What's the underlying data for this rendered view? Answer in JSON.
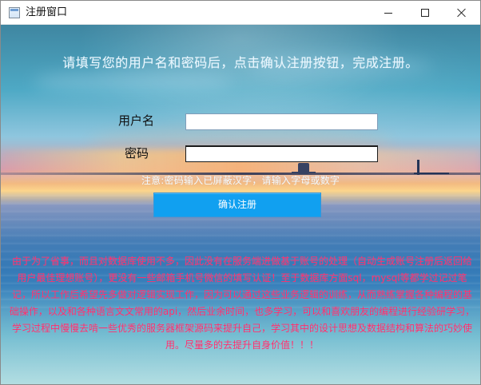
{
  "window": {
    "title": "注册窗口"
  },
  "form": {
    "heading": "请填写您的用户名和密码后，点击确认注册按钮，完成注册。",
    "username_label": "用户名",
    "password_label": "密码",
    "username_value": "",
    "password_value": "",
    "note": "注意:密码输入已屏蔽汉字，请输入字母或数字",
    "submit_label": "确认注册"
  },
  "description": {
    "text": "由于为了省事，而且对数据库使用不多，因此没有在服务端进做基于账号的处理（自动生成账号注册后返回给用户最佳理想账号），更没有一些邮箱手机号微信的填写认证！至于数据库方面sql，mysql等都学过记过笔记，所以工作后希望先多做对逻辑实现工作，因为可以通过这些业务逻辑的训练，从而熟练掌握各种编程的基础操作，以及和各种语言文文常用的api，然后业余时间，也多学习，可以和喜欢朋友的编程进行经验研学习，学习过程中慢慢去啃一些优秀的服务器框架源码来提升自己，学习其中的设计思想及数据结构和算法的巧妙使用。尽量多的去提升自身价值！！！"
  },
  "icons": {
    "app": "window-app-icon",
    "minimize": "minimize-icon",
    "maximize": "maximize-icon",
    "close": "close-icon"
  },
  "colors": {
    "button_blue": "#11a0f0",
    "paragraph_pink": "#ff2c6c",
    "heading_text": "#eaf7ff"
  }
}
